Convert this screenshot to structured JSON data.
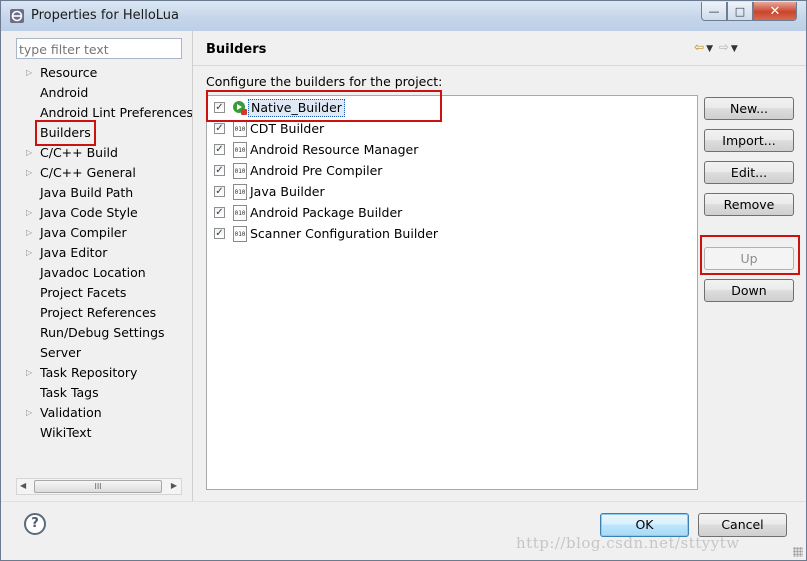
{
  "window": {
    "title": "Properties for HelloLua",
    "minimize_glyph": "—",
    "maximize_glyph": "□",
    "close_glyph": "✕"
  },
  "filter": {
    "placeholder": "type filter text",
    "value": ""
  },
  "nav": {
    "items": [
      {
        "label": "Resource",
        "expandable": true
      },
      {
        "label": "Android",
        "expandable": false
      },
      {
        "label": "Android Lint Preferences",
        "expandable": false
      },
      {
        "label": "Builders",
        "expandable": false,
        "selected": true
      },
      {
        "label": "C/C++ Build",
        "expandable": true
      },
      {
        "label": "C/C++ General",
        "expandable": true
      },
      {
        "label": "Java Build Path",
        "expandable": false
      },
      {
        "label": "Java Code Style",
        "expandable": true
      },
      {
        "label": "Java Compiler",
        "expandable": true
      },
      {
        "label": "Java Editor",
        "expandable": true
      },
      {
        "label": "Javadoc Location",
        "expandable": false
      },
      {
        "label": "Project Facets",
        "expandable": false
      },
      {
        "label": "Project References",
        "expandable": false
      },
      {
        "label": "Run/Debug Settings",
        "expandable": false
      },
      {
        "label": "Server",
        "expandable": false
      },
      {
        "label": "Task Repository",
        "expandable": true
      },
      {
        "label": "Task Tags",
        "expandable": false
      },
      {
        "label": "Validation",
        "expandable": true
      },
      {
        "label": "WikiText",
        "expandable": false
      }
    ],
    "scroll_thumb_glyph": "III"
  },
  "page": {
    "title": "Builders",
    "description": "Configure the builders for the project:",
    "builders": [
      {
        "label": "Native_Builder",
        "checked": true,
        "selected": true,
        "icon": "native-builder-icon"
      },
      {
        "label": "CDT Builder",
        "checked": true,
        "icon": "binary-builder-icon"
      },
      {
        "label": "Android Resource Manager",
        "checked": true,
        "icon": "binary-builder-icon"
      },
      {
        "label": "Android Pre Compiler",
        "checked": true,
        "icon": "binary-builder-icon"
      },
      {
        "label": "Java Builder",
        "checked": true,
        "icon": "binary-builder-icon"
      },
      {
        "label": "Android Package Builder",
        "checked": true,
        "icon": "binary-builder-icon"
      },
      {
        "label": "Scanner Configuration Builder",
        "checked": true,
        "icon": "binary-builder-icon"
      }
    ],
    "builder_icon_text": "010",
    "buttons": {
      "new": "New...",
      "import": "Import...",
      "edit": "Edit...",
      "remove": "Remove",
      "up": "Up",
      "down": "Down"
    }
  },
  "footer": {
    "help_glyph": "?",
    "ok": "OK",
    "cancel": "Cancel",
    "watermark": "http://blog.csdn.net/sttyytw"
  },
  "colors": {
    "highlight_box": "#cc1111",
    "selection": "#dfe9f6",
    "default_button": "#3c7fb1"
  }
}
